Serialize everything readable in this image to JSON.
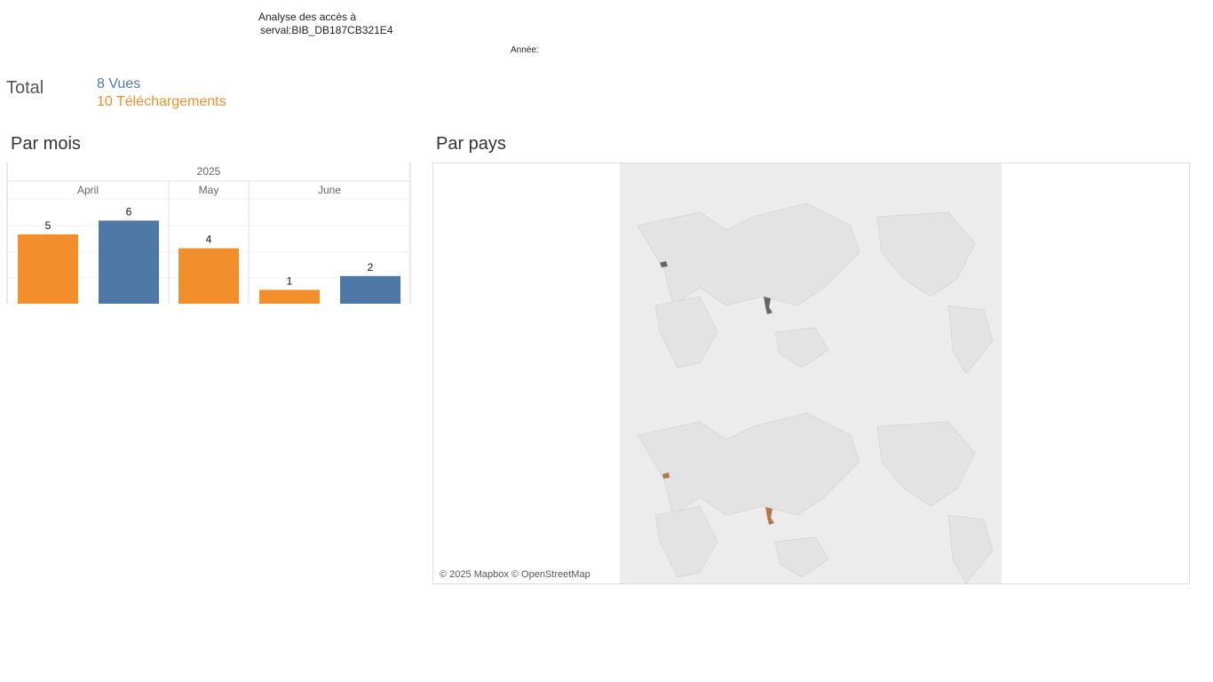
{
  "header": {
    "title_line1": "Analyse des accès à",
    "title_line2": "serval:BIB_DB187CB321E4",
    "year_filter_label": "Année:"
  },
  "totals": {
    "label": "Total",
    "views": "8 Vues",
    "downloads": "10 Téléchargements"
  },
  "sections": {
    "by_month": "Par mois",
    "by_country": "Par pays"
  },
  "map": {
    "attribution": "© 2025 Mapbox © OpenStreetMap",
    "panels": [
      "views",
      "downloads"
    ]
  },
  "colors": {
    "views": "#4e79a7",
    "downloads": "#f28e2b"
  },
  "chart_data": {
    "type": "bar",
    "year": "2025",
    "categories": [
      "April",
      "May",
      "June"
    ],
    "series": [
      {
        "values": [
          5,
          null,
          1
        ],
        "color": "#f28e2b"
      },
      {
        "values": [
          6,
          null,
          2
        ],
        "color": "#4e79a7"
      }
    ],
    "bars": [
      {
        "month": "April",
        "value": 5,
        "color": "#f28e2b"
      },
      {
        "month": "April",
        "value": 6,
        "color": "#4e79a7"
      },
      {
        "month": "May",
        "value": 4,
        "color": "#f28e2b"
      },
      {
        "month": "June",
        "value": 1,
        "color": "#f28e2b"
      },
      {
        "month": "June",
        "value": 2,
        "color": "#4e79a7"
      }
    ],
    "ylim": [
      0,
      6
    ],
    "grid": true
  }
}
